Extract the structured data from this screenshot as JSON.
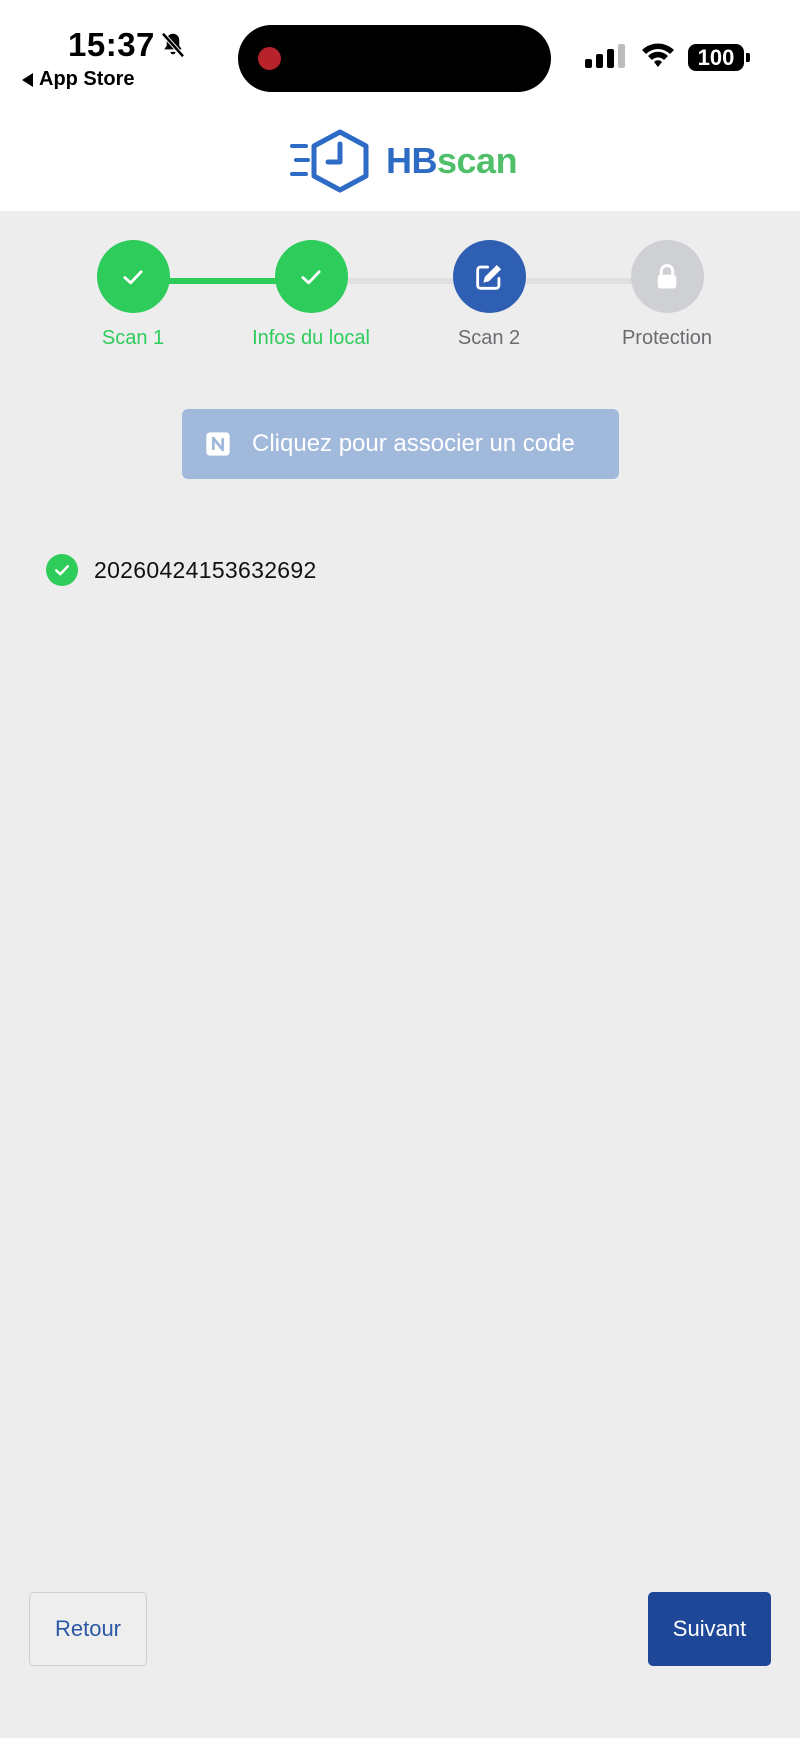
{
  "status_bar": {
    "time": "15:37",
    "back_app": "App Store",
    "battery": "100",
    "icons": [
      "bell-slash-icon",
      "signal-icon",
      "wifi-icon",
      "battery-icon"
    ]
  },
  "header": {
    "logo_hb": "HB",
    "logo_scan": "scan",
    "colors": {
      "hb": "#2e6bc4",
      "scan": "#4fbf6a"
    }
  },
  "stepper": {
    "steps": [
      {
        "label": "Scan 1",
        "state": "done",
        "icon": "check-icon"
      },
      {
        "label": "Infos du local",
        "state": "done",
        "icon": "check-icon"
      },
      {
        "label": "Scan 2",
        "state": "active",
        "icon": "edit-icon"
      },
      {
        "label": "Protection",
        "state": "locked",
        "icon": "lock-icon"
      }
    ],
    "colors": {
      "done": "#2ecc5a",
      "active": "#2e5fb3",
      "locked": "#cfd0d4",
      "line_pending": "#e0e0e2"
    }
  },
  "main": {
    "associate_button": "Cliquez pour associer un code",
    "scanned_codes": [
      "20260424153632692"
    ]
  },
  "footer": {
    "back_label": "Retour",
    "next_label": "Suivant"
  }
}
